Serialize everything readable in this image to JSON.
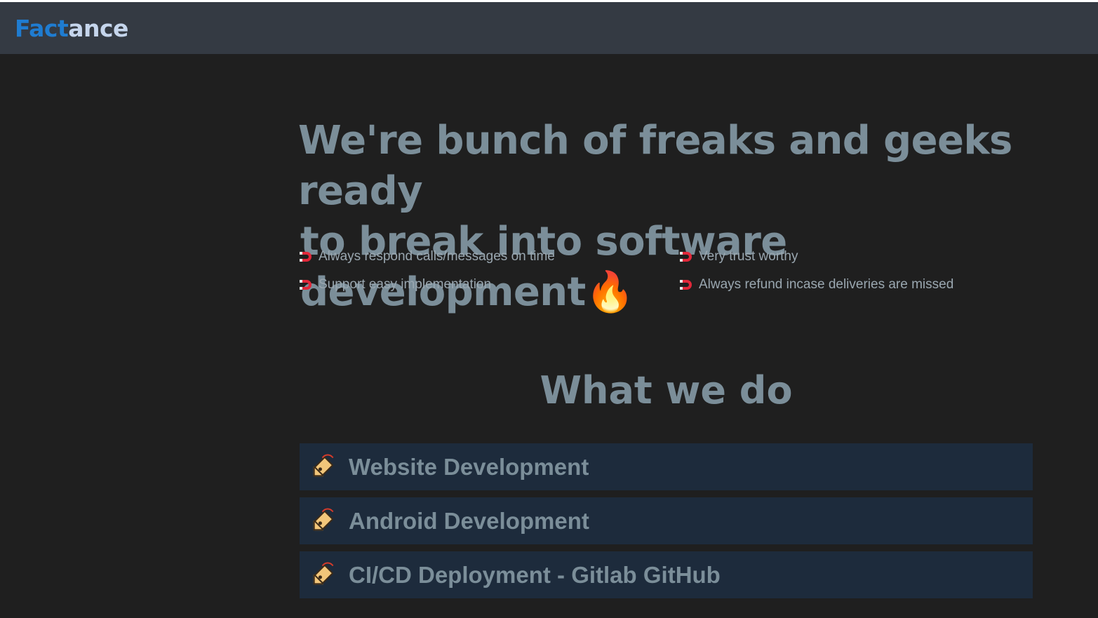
{
  "navbar": {
    "brand_part1": "Fact",
    "brand_part2": "ance",
    "brand_color_primary": "#1f7cd1",
    "brand_color_secondary": "#c5d5ec"
  },
  "hero": {
    "line1": "We're bunch of freaks and geeks ready",
    "line2": "to break into software development",
    "emoji": "🔥",
    "emoji_icon": "fire-icon"
  },
  "features": [
    {
      "icon": "magnet-icon",
      "label": "Always respond calls/messages on time"
    },
    {
      "icon": "magnet-icon",
      "label": "Very trust worthy"
    },
    {
      "icon": "magnet-icon",
      "label": "Support easy implementation"
    },
    {
      "icon": "magnet-icon",
      "label": "Always refund incase deliveries are missed"
    }
  ],
  "services_section": {
    "title": "What we do",
    "items": [
      {
        "icon": "tag-icon",
        "label": "Website Development"
      },
      {
        "icon": "tag-icon",
        "label": "Android Development"
      },
      {
        "icon": "tag-icon",
        "label": "CI/CD Deployment - Gitlab GitHub"
      }
    ]
  },
  "colors": {
    "background": "#1f1f1f",
    "navbar": "#343a43",
    "heading_text": "#7b8e99",
    "service_card": "#1d2b3c",
    "magnet_red": "#e2283a"
  }
}
